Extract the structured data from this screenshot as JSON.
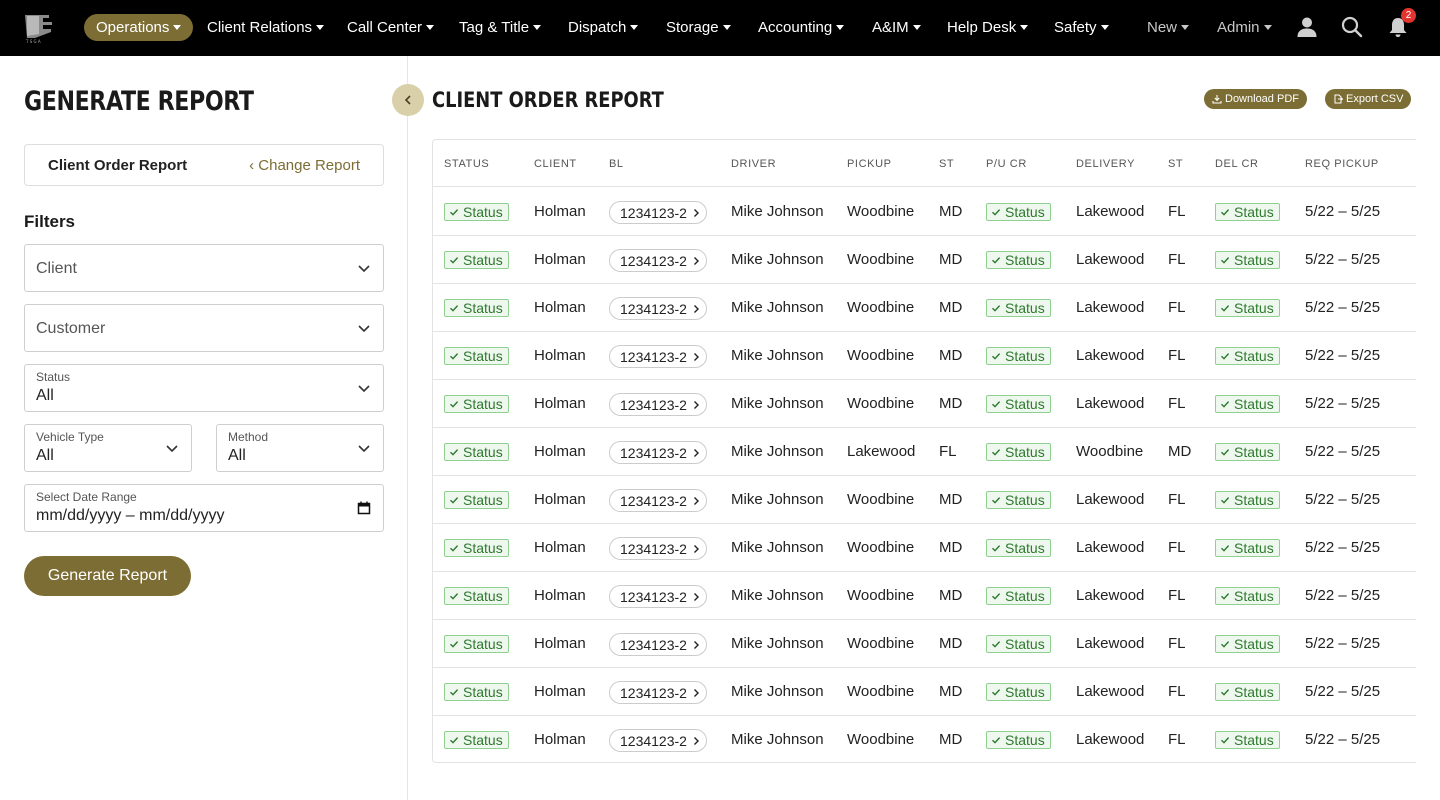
{
  "nav": {
    "items": [
      {
        "label": "Operations",
        "active": true
      },
      {
        "label": "Client Relations"
      },
      {
        "label": "Call Center"
      },
      {
        "label": "Tag & Title"
      },
      {
        "label": "Dispatch"
      },
      {
        "label": "Storage"
      },
      {
        "label": "Accounting"
      },
      {
        "label": "A&IM"
      },
      {
        "label": "Help Desk"
      },
      {
        "label": "Safety"
      },
      {
        "label": "New"
      },
      {
        "label": "Admin"
      }
    ],
    "notification_count": "2",
    "icons": [
      "user-icon",
      "search-icon",
      "bell-icon"
    ]
  },
  "left": {
    "page_title": "GENERATE REPORT",
    "report_name": "Client Order Report",
    "change_report": "Change Report",
    "filters_heading": "Filters",
    "client_placeholder": "Client",
    "customer_placeholder": "Customer",
    "status_label": "Status",
    "status_value": "All",
    "vehicle_type_label": "Vehicle Type",
    "vehicle_type_value": "All",
    "method_label": "Method",
    "method_value": "All",
    "date_range_label": "Select Date Range",
    "date_range_value": "mm/dd/yyyy – mm/dd/yyyy",
    "generate_button": "Generate Report"
  },
  "report": {
    "title": "CLIENT ORDER REPORT",
    "download_pdf": "Download PDF",
    "export_csv": "Export CSV",
    "columns": [
      "STATUS",
      "CLIENT",
      "BL",
      "DRIVER",
      "PICKUP",
      "ST",
      "P/U CR",
      "DELIVERY",
      "ST",
      "DEL CR",
      "REQ PICKUP"
    ],
    "rows": [
      {
        "status": "Status",
        "client": "Holman",
        "bl": "1234123-2",
        "driver": "Mike Johnson",
        "pickup": "Woodbine",
        "pickup_st": "MD",
        "pu_cr": "Status",
        "delivery": "Lakewood",
        "delivery_st": "FL",
        "del_cr": "Status",
        "req_pickup": "5/22 – 5/25"
      },
      {
        "status": "Status",
        "client": "Holman",
        "bl": "1234123-2",
        "driver": "Mike Johnson",
        "pickup": "Woodbine",
        "pickup_st": "MD",
        "pu_cr": "Status",
        "delivery": "Lakewood",
        "delivery_st": "FL",
        "del_cr": "Status",
        "req_pickup": "5/22 – 5/25"
      },
      {
        "status": "Status",
        "client": "Holman",
        "bl": "1234123-2",
        "driver": "Mike Johnson",
        "pickup": "Woodbine",
        "pickup_st": "MD",
        "pu_cr": "Status",
        "delivery": "Lakewood",
        "delivery_st": "FL",
        "del_cr": "Status",
        "req_pickup": "5/22 – 5/25"
      },
      {
        "status": "Status",
        "client": "Holman",
        "bl": "1234123-2",
        "driver": "Mike Johnson",
        "pickup": "Woodbine",
        "pickup_st": "MD",
        "pu_cr": "Status",
        "delivery": "Lakewood",
        "delivery_st": "FL",
        "del_cr": "Status",
        "req_pickup": "5/22 – 5/25"
      },
      {
        "status": "Status",
        "client": "Holman",
        "bl": "1234123-2",
        "driver": "Mike Johnson",
        "pickup": "Woodbine",
        "pickup_st": "MD",
        "pu_cr": "Status",
        "delivery": "Lakewood",
        "delivery_st": "FL",
        "del_cr": "Status",
        "req_pickup": "5/22 – 5/25"
      },
      {
        "status": "Status",
        "client": "Holman",
        "bl": "1234123-2",
        "driver": "Mike Johnson",
        "pickup": "Lakewood",
        "pickup_st": "FL",
        "pu_cr": "Status",
        "delivery": "Woodbine",
        "delivery_st": "MD",
        "del_cr": "Status",
        "req_pickup": "5/22 – 5/25"
      },
      {
        "status": "Status",
        "client": "Holman",
        "bl": "1234123-2",
        "driver": "Mike Johnson",
        "pickup": "Woodbine",
        "pickup_st": "MD",
        "pu_cr": "Status",
        "delivery": "Lakewood",
        "delivery_st": "FL",
        "del_cr": "Status",
        "req_pickup": "5/22 – 5/25"
      },
      {
        "status": "Status",
        "client": "Holman",
        "bl": "1234123-2",
        "driver": "Mike Johnson",
        "pickup": "Woodbine",
        "pickup_st": "MD",
        "pu_cr": "Status",
        "delivery": "Lakewood",
        "delivery_st": "FL",
        "del_cr": "Status",
        "req_pickup": "5/22 – 5/25"
      },
      {
        "status": "Status",
        "client": "Holman",
        "bl": "1234123-2",
        "driver": "Mike Johnson",
        "pickup": "Woodbine",
        "pickup_st": "MD",
        "pu_cr": "Status",
        "delivery": "Lakewood",
        "delivery_st": "FL",
        "del_cr": "Status",
        "req_pickup": "5/22 – 5/25"
      },
      {
        "status": "Status",
        "client": "Holman",
        "bl": "1234123-2",
        "driver": "Mike Johnson",
        "pickup": "Woodbine",
        "pickup_st": "MD",
        "pu_cr": "Status",
        "delivery": "Lakewood",
        "delivery_st": "FL",
        "del_cr": "Status",
        "req_pickup": "5/22 – 5/25"
      },
      {
        "status": "Status",
        "client": "Holman",
        "bl": "1234123-2",
        "driver": "Mike Johnson",
        "pickup": "Woodbine",
        "pickup_st": "MD",
        "pu_cr": "Status",
        "delivery": "Lakewood",
        "delivery_st": "FL",
        "del_cr": "Status",
        "req_pickup": "5/22 – 5/25"
      },
      {
        "status": "Status",
        "client": "Holman",
        "bl": "1234123-2",
        "driver": "Mike Johnson",
        "pickup": "Woodbine",
        "pickup_st": "MD",
        "pu_cr": "Status",
        "delivery": "Lakewood",
        "delivery_st": "FL",
        "del_cr": "Status",
        "req_pickup": "5/22 – 5/25"
      }
    ]
  },
  "colors": {
    "brand": "#7c6d34",
    "nav_bg": "#000000",
    "status_green": "#2f7a2f",
    "badge_red": "#e3342f"
  }
}
